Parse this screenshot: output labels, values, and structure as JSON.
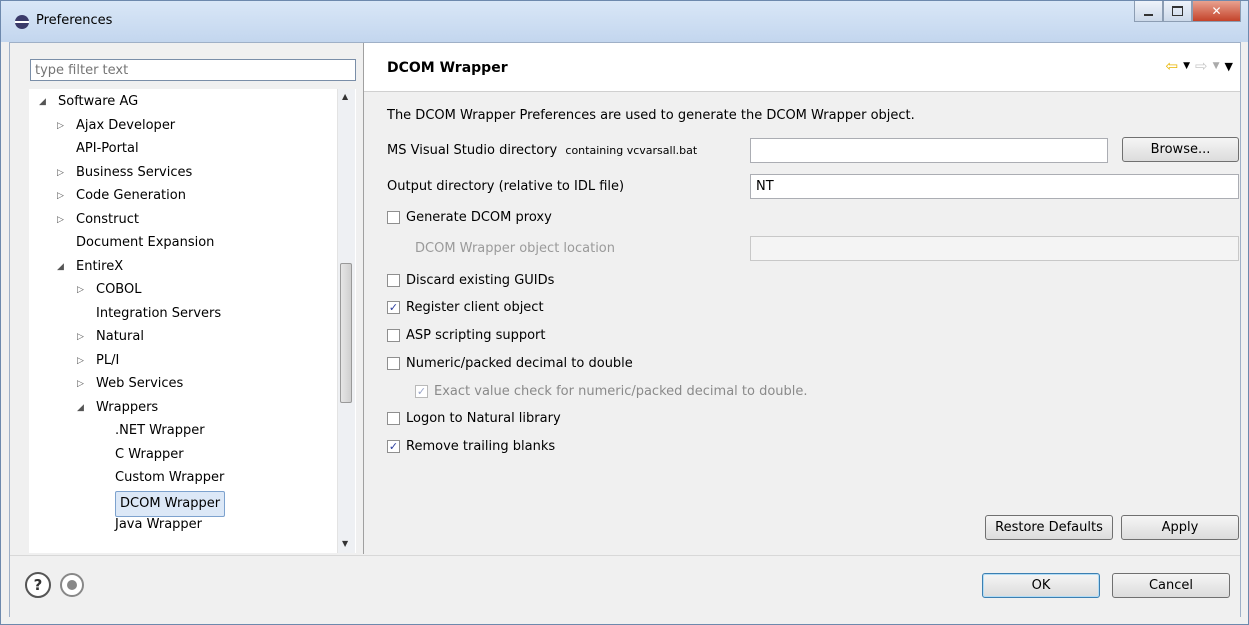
{
  "window": {
    "title": "Preferences"
  },
  "filter": {
    "placeholder": "type filter text"
  },
  "tree": [
    {
      "label": "Software AG",
      "twisty": "expanded",
      "depth": 0,
      "selected": false
    },
    {
      "label": "Ajax Developer",
      "twisty": "collapsed",
      "depth": 1,
      "selected": false
    },
    {
      "label": "API-Portal",
      "twisty": "none",
      "depth": 1,
      "selected": false
    },
    {
      "label": "Business Services",
      "twisty": "collapsed",
      "depth": 1,
      "selected": false
    },
    {
      "label": "Code Generation",
      "twisty": "collapsed",
      "depth": 1,
      "selected": false
    },
    {
      "label": "Construct",
      "twisty": "collapsed",
      "depth": 1,
      "selected": false
    },
    {
      "label": "Document Expansion",
      "twisty": "none",
      "depth": 1,
      "selected": false
    },
    {
      "label": "EntireX",
      "twisty": "expanded",
      "depth": 1,
      "selected": false
    },
    {
      "label": "COBOL",
      "twisty": "collapsed",
      "depth": 2,
      "selected": false
    },
    {
      "label": "Integration Servers",
      "twisty": "none",
      "depth": 2,
      "selected": false
    },
    {
      "label": "Natural",
      "twisty": "collapsed",
      "depth": 2,
      "selected": false
    },
    {
      "label": "PL/I",
      "twisty": "collapsed",
      "depth": 2,
      "selected": false
    },
    {
      "label": "Web Services",
      "twisty": "collapsed",
      "depth": 2,
      "selected": false
    },
    {
      "label": "Wrappers",
      "twisty": "expanded",
      "depth": 2,
      "selected": false
    },
    {
      "label": ".NET Wrapper",
      "twisty": "none",
      "depth": 3,
      "selected": false
    },
    {
      "label": "C Wrapper",
      "twisty": "none",
      "depth": 3,
      "selected": false
    },
    {
      "label": "Custom Wrapper",
      "twisty": "none",
      "depth": 3,
      "selected": false
    },
    {
      "label": "DCOM Wrapper",
      "twisty": "none",
      "depth": 3,
      "selected": true
    },
    {
      "label": "Java Wrapper",
      "twisty": "none",
      "depth": 3,
      "selected": false
    }
  ],
  "page": {
    "title": "DCOM Wrapper",
    "description": "The DCOM Wrapper Preferences are used to generate the DCOM Wrapper object.",
    "vs_dir_label": "MS Visual Studio directory",
    "vs_dir_hint": "containing vcvarsall.bat",
    "vs_dir_value": "",
    "browse_label": "Browse...",
    "output_dir_label": "Output directory (relative to IDL file)",
    "output_dir_value": "NT",
    "generate_proxy_label": "Generate DCOM proxy",
    "object_location_label": "DCOM Wrapper object location",
    "object_location_value": "",
    "discard_guids_label": "Discard existing GUIDs",
    "register_client_label": "Register client object",
    "asp_label": "ASP scripting support",
    "numeric_label": "Numeric/packed decimal to double",
    "exact_check_label": "Exact value check for numeric/packed decimal to double.",
    "logon_label": "Logon to Natural library",
    "remove_blanks_label": "Remove trailing blanks",
    "restore_defaults_label": "Restore Defaults",
    "apply_label": "Apply"
  },
  "checkboxes": {
    "generate_proxy": false,
    "discard_guids": false,
    "register_client": true,
    "asp": false,
    "numeric": false,
    "exact_check": true,
    "logon": false,
    "remove_blanks": true
  },
  "footer": {
    "ok_label": "OK",
    "cancel_label": "Cancel"
  },
  "icons": {
    "app": "eclipse-icon",
    "back": "back-arrow-icon",
    "forward": "forward-arrow-icon",
    "help": "help-icon",
    "record": "record-icon"
  },
  "colors": {
    "accent": "#3c7fb1",
    "selection": "#dce8f7",
    "back_arrow": "#e8b400"
  }
}
